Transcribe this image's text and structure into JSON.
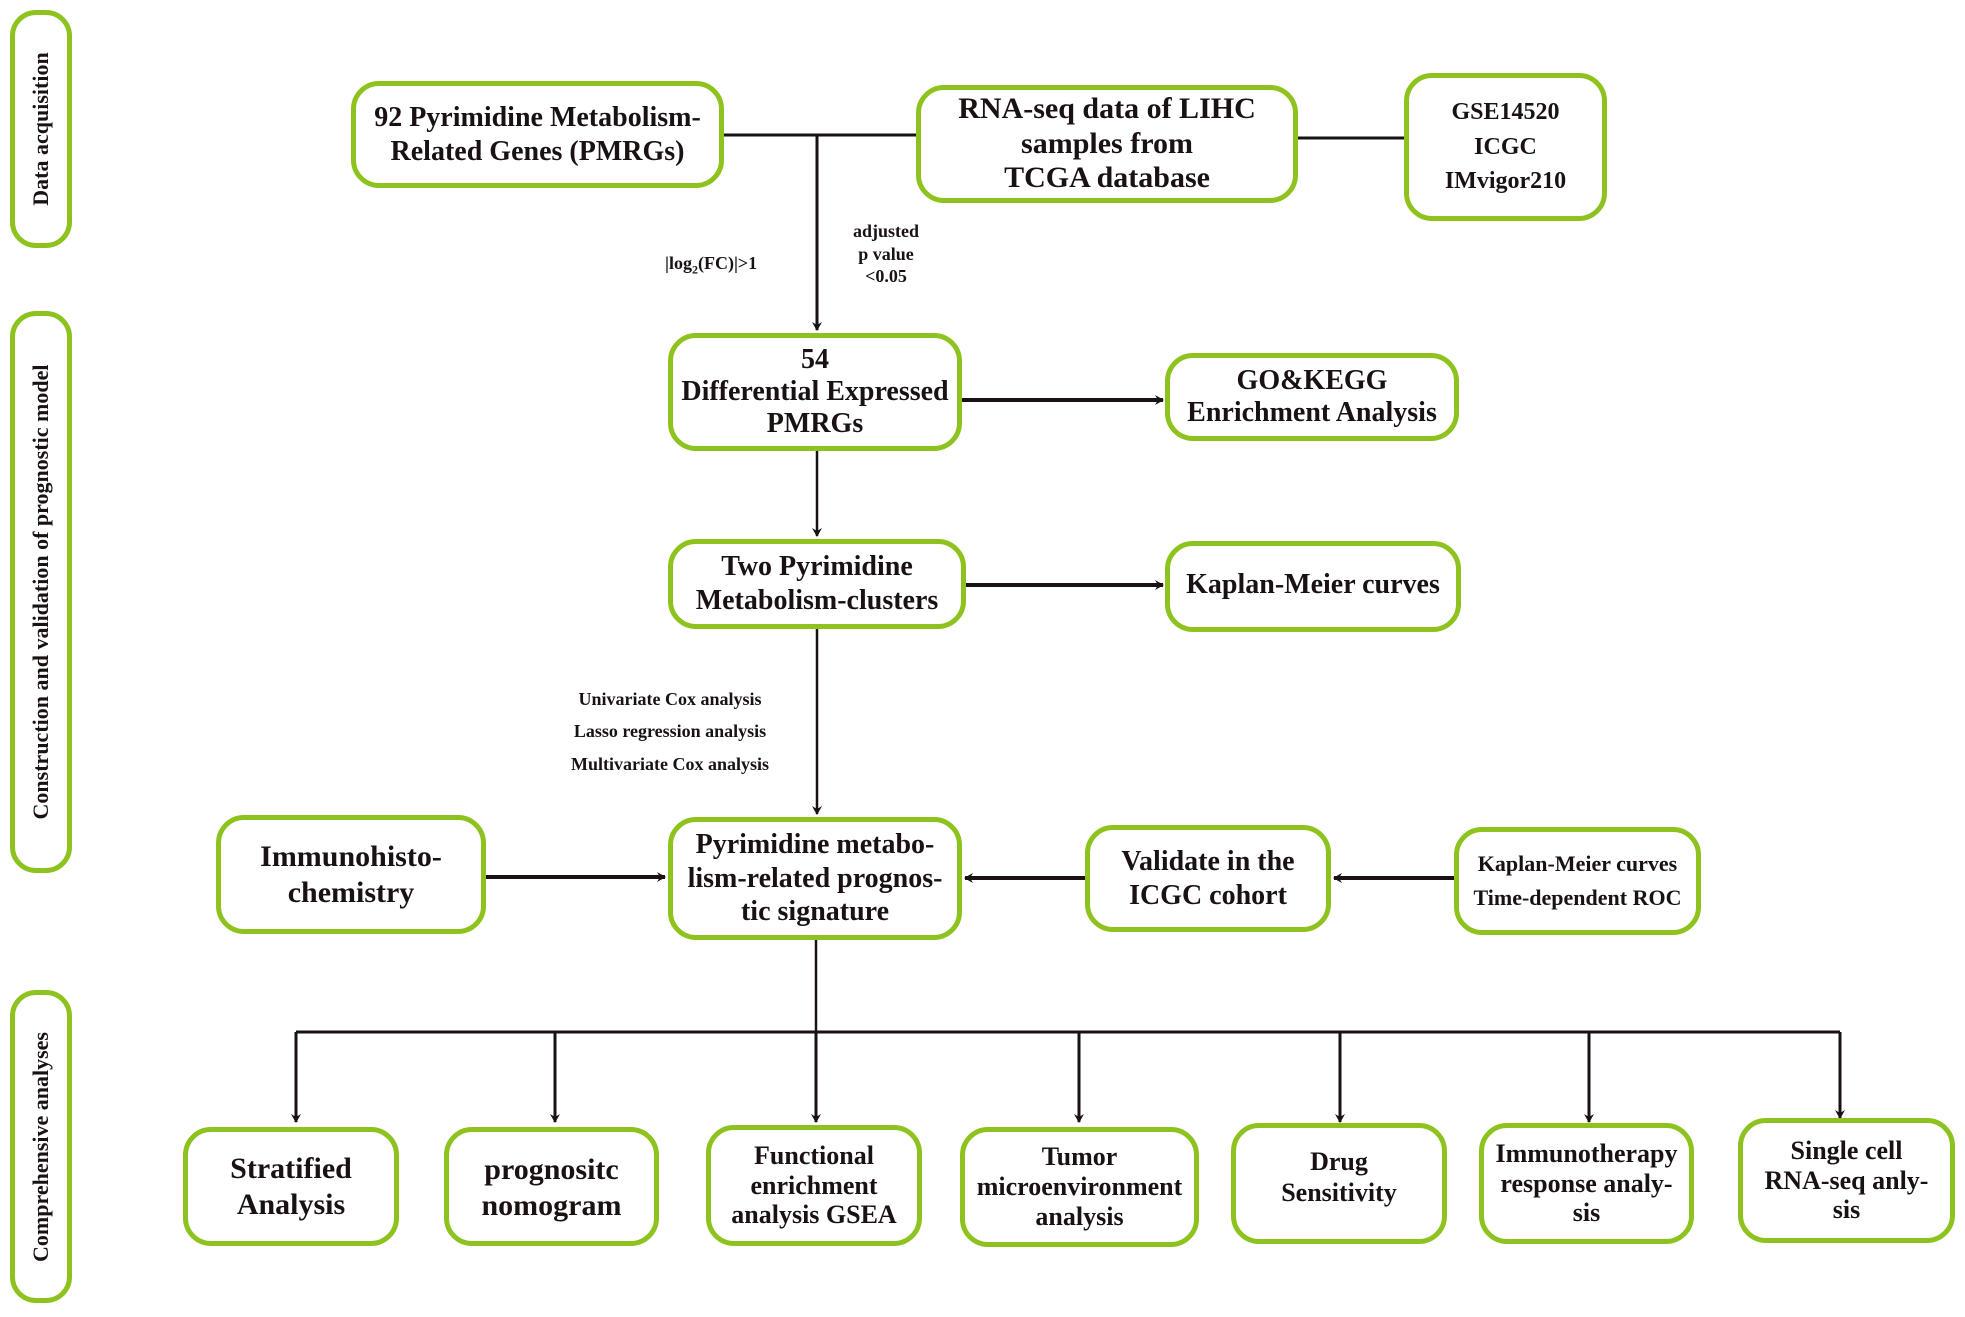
{
  "phases": {
    "data_acquisition": "Data acquisition",
    "construction": "Construction and validation of prognostic model",
    "comprehensive": "Comprehensive analyses"
  },
  "nodes": {
    "pmrgs": [
      "92 Pyrimidine Metabolism-",
      "Related Genes (PMRGs)"
    ],
    "rnaseq": [
      "RNA-seq data of LIHC",
      "samples from",
      "TCGA database"
    ],
    "datasets": [
      "GSE14520",
      "ICGC",
      "IMvigor210"
    ],
    "degs": [
      "54",
      "Differential Expressed",
      "PMRGs"
    ],
    "gokegg": [
      "GO&KEGG",
      "Enrichment Analysis"
    ],
    "clusters": [
      "Two Pyrimidine",
      "Metabolism-clusters"
    ],
    "km_clusters": [
      "Kaplan-Meier curves"
    ],
    "signature": [
      "Pyrimidine metabo-",
      "lism-related prognos-",
      "tic signature"
    ],
    "ihc": [
      "Immunohisto-",
      "chemistry"
    ],
    "validate": [
      "Validate in the",
      "ICGC cohort"
    ],
    "km_roc": [
      "Kaplan-Meier curves",
      "Time-dependent ROC"
    ],
    "stratified": [
      "Stratified",
      "Analysis"
    ],
    "nomogram": [
      "prognositc",
      "nomogram"
    ],
    "gsea": [
      "Functional",
      "enrichment",
      "analysis GSEA"
    ],
    "tme": [
      "Tumor",
      "microenvironment",
      "analysis"
    ],
    "drug": [
      "Drug",
      "Sensitivity"
    ],
    "immunotherapy": [
      "Immunotherapy",
      "response analy-",
      "sis"
    ],
    "scrna": [
      "Single cell",
      "RNA-seq anly-",
      "sis"
    ]
  },
  "edge_labels": {
    "logfc_prefix": "|log",
    "logfc_sub": "2",
    "logfc_suffix": "(FC)|>1",
    "adjusted_p": [
      "adjusted",
      "p value",
      "<0.05"
    ],
    "methods": [
      "Univariate Cox analysis",
      "Lasso regression analysis",
      "Multivariate Cox analysis"
    ]
  },
  "colors": {
    "box_border": "#8dc21f",
    "line": "#1a1212",
    "text": "#1a1212"
  }
}
